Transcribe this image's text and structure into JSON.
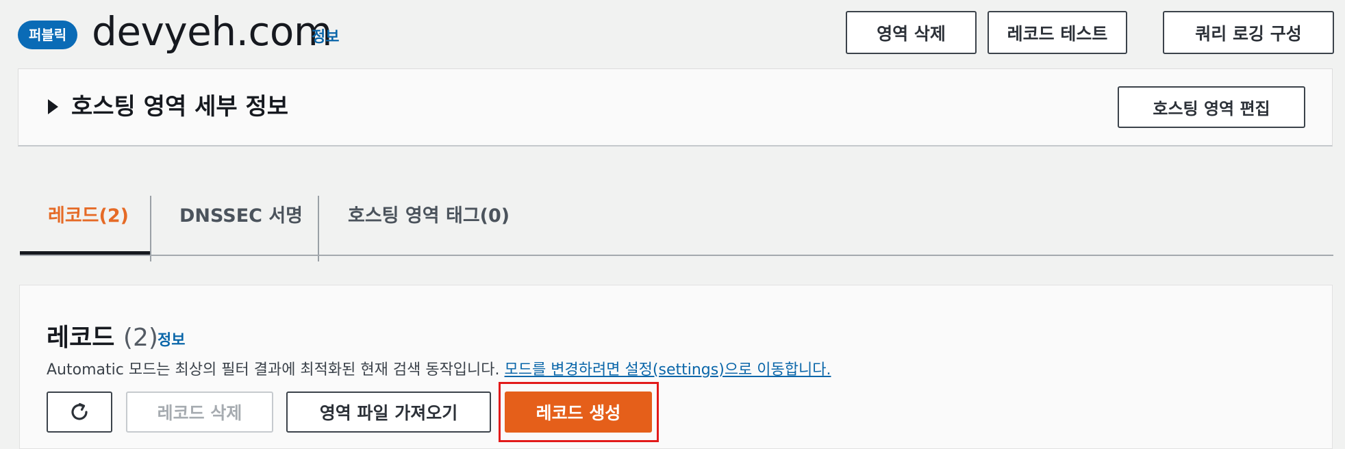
{
  "header": {
    "badge": "퍼블릭",
    "title": "devyeh.com",
    "info": "정보",
    "buttons": {
      "delete_zone": "영역 삭제",
      "test_record": "레코드 테스트",
      "query_logging": "쿼리 로깅 구성"
    }
  },
  "details_panel": {
    "title": "호스팅 영역 세부 정보",
    "edit_button": "호스팅 영역 편집",
    "expand_icon": "caret-right-icon"
  },
  "tabs": [
    {
      "label": "레코드(2)",
      "active": true
    },
    {
      "label": "DNSSEC 서명",
      "active": false
    },
    {
      "label": "호스팅 영역 태그(0)",
      "active": false
    }
  ],
  "records": {
    "title": "레코드",
    "count": "(2)",
    "info": "정보",
    "description": "Automatic 모드는 최상의 필터 결과에 최적화된 현재 검색 동작입니다. ",
    "description_link": "모드를 변경하려면 설정(settings)으로 이동합니다.",
    "buttons": {
      "refresh_icon": "refresh-icon",
      "delete": "레코드 삭제",
      "import_zone_file": "영역 파일 가져오기",
      "create": "레코드 생성"
    }
  },
  "colors": {
    "accent_orange": "#e55f1a",
    "link_blue": "#0a66a9",
    "badge_blue": "#0a6bb6",
    "highlight_red": "#e21a1a"
  }
}
